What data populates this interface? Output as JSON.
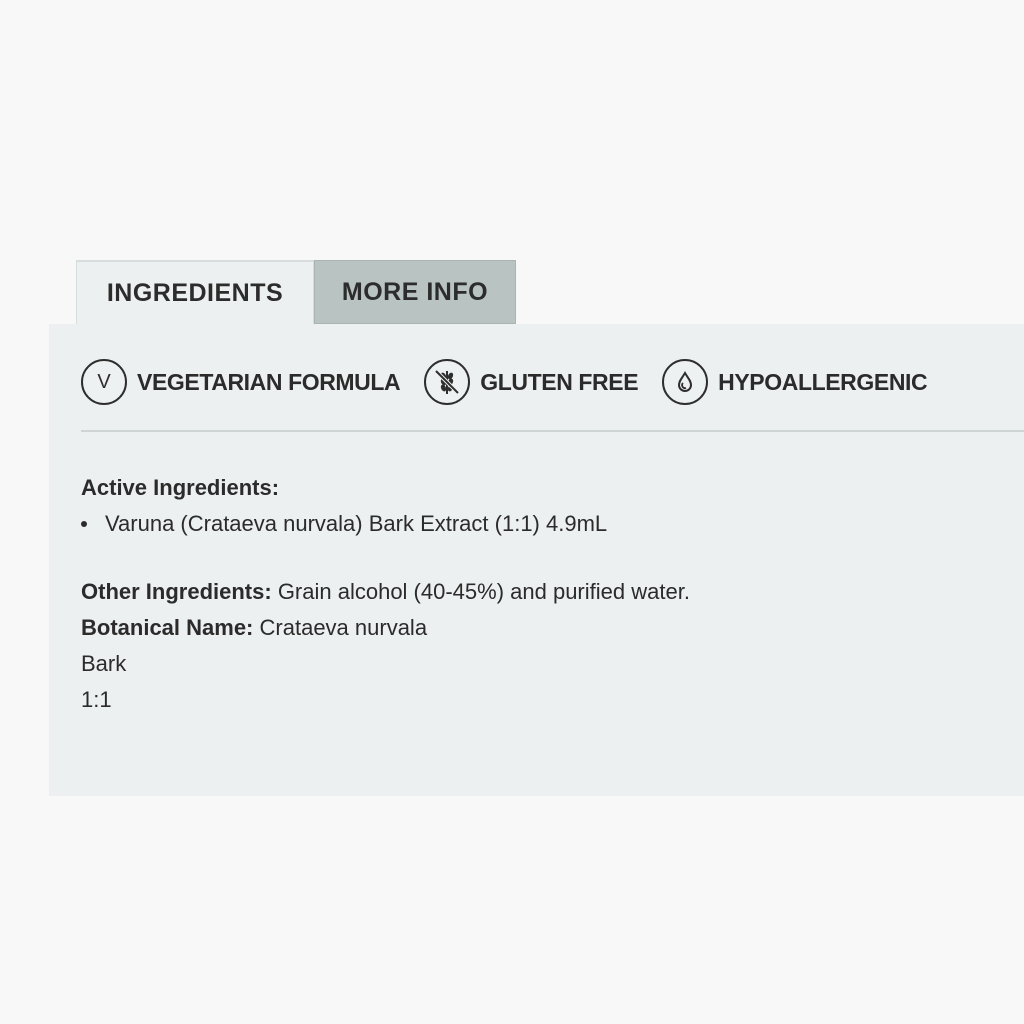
{
  "tabs": [
    {
      "label": "INGREDIENTS",
      "active": true
    },
    {
      "label": "MORE INFO",
      "active": false
    }
  ],
  "badges": [
    {
      "icon": "v-letter-icon",
      "glyph": "V",
      "label": "VEGETARIAN FORMULA"
    },
    {
      "icon": "wheat-crossed-icon",
      "label": "GLUTEN FREE"
    },
    {
      "icon": "droplet-icon",
      "label": "HYPOALLERGENIC"
    }
  ],
  "active_ingredients": {
    "heading": "Active Ingredients:",
    "items": [
      "Varuna (Crataeva nurvala) Bark Extract (1:1) 4.9mL"
    ]
  },
  "other_ingredients": {
    "label": "Other Ingredients:",
    "value": "Grain alcohol (40-45%) and purified water."
  },
  "botanical_name": {
    "label": "Botanical Name:",
    "value": "Crataeva nurvala"
  },
  "plant_part": "Bark",
  "ratio": "1:1",
  "colors": {
    "panel_bg": "#edf0f0",
    "inactive_tab_bg": "#b9c3c2",
    "text": "#2b2b2b"
  }
}
